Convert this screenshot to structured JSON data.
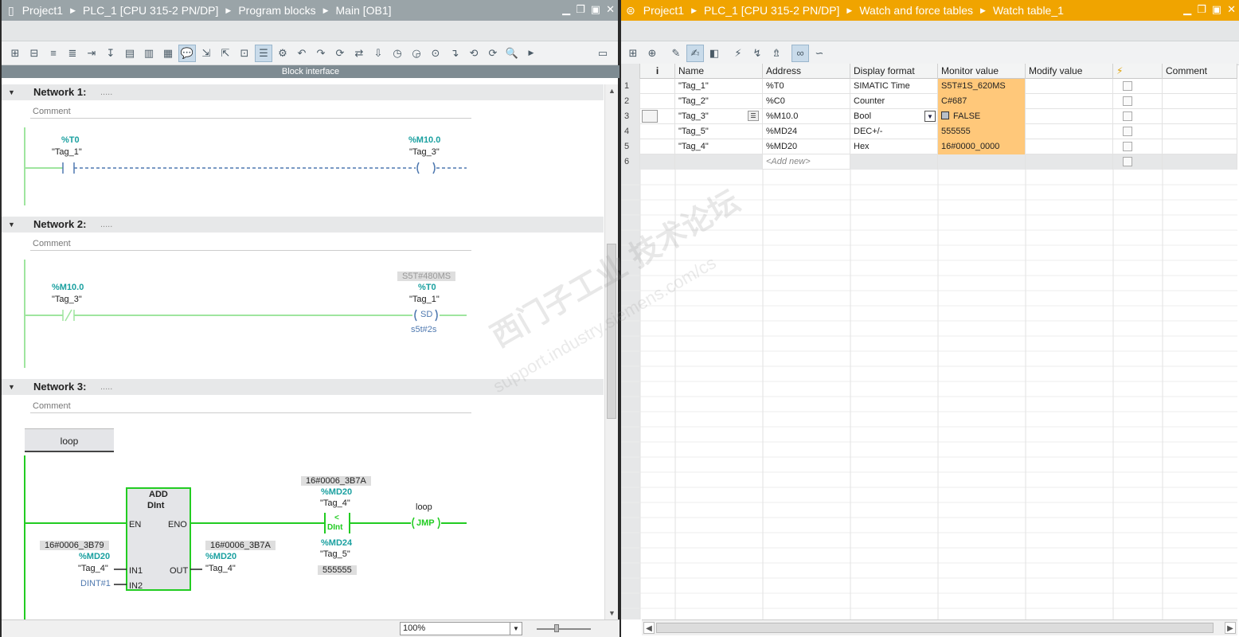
{
  "left": {
    "breadcrumb": [
      "Project1",
      "PLC_1 [CPU 315-2 PN/DP]",
      "Program blocks",
      "Main [OB1]"
    ],
    "block_interface": "Block interface",
    "zoom": "100%",
    "networks": [
      {
        "title": "Network 1:",
        "dots": ".....",
        "comment": "Comment",
        "contact_addr": "%T0",
        "contact_tag": "\"Tag_1\"",
        "coil_addr": "%M10.0",
        "coil_tag": "\"Tag_3\""
      },
      {
        "title": "Network 2:",
        "dots": ".....",
        "comment": "Comment",
        "contact_addr": "%M10.0",
        "contact_tag": "\"Tag_3\"",
        "timer_value": "S5T#480MS",
        "coil_addr": "%T0",
        "coil_tag": "\"Tag_1\"",
        "coil_label": "SD",
        "preset": "s5t#2s"
      },
      {
        "title": "Network 3:",
        "dots": ".....",
        "comment": "Comment",
        "label": "loop",
        "add_title": "ADD",
        "add_type": "DInt",
        "en": "EN",
        "eno": "ENO",
        "in1": "IN1",
        "in2": "IN2",
        "out": "OUT",
        "in1_value": "16#0006_3B79",
        "in1_addr": "%MD20",
        "in1_tag": "\"Tag_4\"",
        "in2_value": "DINT#1",
        "out_value": "16#0006_3B7A",
        "out_addr": "%MD20",
        "out_tag": "\"Tag_4\"",
        "cmp_top_value": "16#0006_3B7A",
        "cmp_top_addr": "%MD20",
        "cmp_top_tag": "\"Tag_4\"",
        "cmp_op": "<",
        "cmp_type": "DInt",
        "cmp_bot_addr": "%MD24",
        "cmp_bot_tag": "\"Tag_5\"",
        "cmp_bot_value": "555555",
        "jmp_label": "loop",
        "jmp": "JMP"
      }
    ]
  },
  "right": {
    "breadcrumb": [
      "Project1",
      "PLC_1 [CPU 315-2 PN/DP]",
      "Watch and force tables",
      "Watch table_1"
    ],
    "columns": [
      "i",
      "Name",
      "Address",
      "Display format",
      "Monitor value",
      "Modify value",
      "",
      "Comment"
    ],
    "rows": [
      {
        "num": "1",
        "name": "\"Tag_1\"",
        "address": "%T0",
        "format": "SIMATIC Time",
        "monitor": "S5T#1S_620MS"
      },
      {
        "num": "2",
        "name": "\"Tag_2\"",
        "address": "%C0",
        "format": "Counter",
        "monitor": "C#687"
      },
      {
        "num": "3",
        "name": "\"Tag_3\"",
        "address": "%M10.0",
        "format": "Bool",
        "monitor": "FALSE"
      },
      {
        "num": "4",
        "name": "\"Tag_5\"",
        "address": "%MD24",
        "format": "DEC+/-",
        "monitor": "555555"
      },
      {
        "num": "5",
        "name": "\"Tag_4\"",
        "address": "%MD20",
        "format": "Hex",
        "monitor": "16#0000_0000"
      },
      {
        "num": "6",
        "name": "",
        "address": "<Add new>",
        "format": "",
        "monitor": ""
      }
    ],
    "watermark_cn": "西门子工业 技术论坛",
    "watermark_url": "support.industry.siemens.com/cs"
  },
  "colors": {
    "left_title": "#9aa4a8",
    "right_title": "#f0a400",
    "monitor": "#ffc87a",
    "ladder_green": "#00c000",
    "addr_teal": "#1aa0a0"
  }
}
